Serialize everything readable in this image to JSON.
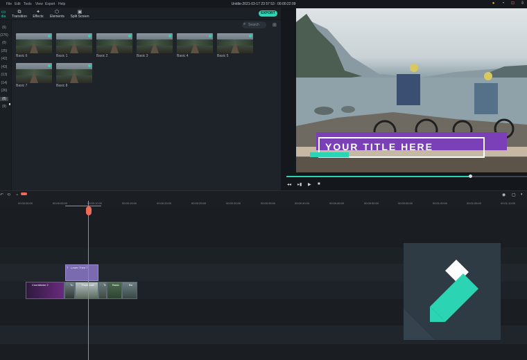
{
  "menubar": {
    "items": [
      "File",
      "Edit",
      "Tools",
      "View",
      "Export",
      "Help"
    ],
    "title": "Untitle-2021-03-17 23 57 53 : 00:00:22:09"
  },
  "tabs": [
    {
      "label": "dia",
      "icon": "media-icon"
    },
    {
      "label": "Transition",
      "icon": "transition-icon"
    },
    {
      "label": "Effects",
      "icon": "effects-icon"
    },
    {
      "label": "Elements",
      "icon": "elements-icon"
    },
    {
      "label": "Split Screen",
      "icon": "split-screen-icon"
    }
  ],
  "export_label": "EXPORT",
  "search_placeholder": "Search",
  "categories": [
    "(6)",
    "(276)",
    "(0)",
    "(25)",
    "(42)",
    "(43)",
    "(13)",
    "(14)",
    "(26)",
    "(8)",
    "(9)"
  ],
  "thumbnails": [
    "Basic 6",
    "Basic 1",
    "Basic 2",
    "Basic 3",
    "Basic 4",
    "Basic 5",
    "Basic 7",
    "Basic 8"
  ],
  "video_title": "YOUR TITLE HERE",
  "ruler_ticks": [
    "00:00:00:00",
    "00:00:05:00",
    "00:00:10:00",
    "00:00:15:00",
    "00:00:20:00",
    "00:00:25:00",
    "00:00:30:00",
    "00:00:35:00",
    "00:00:40:00",
    "00:00:45:00",
    "00:00:50:00",
    "00:00:55:00",
    "00:01:00:00",
    "00:01:05:00",
    "00:01:10:00",
    "00:01:15:00"
  ],
  "title_clip_label": "Lower Third 7",
  "video_clips": [
    "Countdown 2",
    "Tu",
    "Thumbnail",
    "Tu",
    "Basic",
    "Ba"
  ],
  "colors": {
    "accent": "#2bd4b2",
    "playhead": "#f06a5a",
    "title_clip": "#7a6bb0",
    "title_bar": "#7b3fb8"
  }
}
